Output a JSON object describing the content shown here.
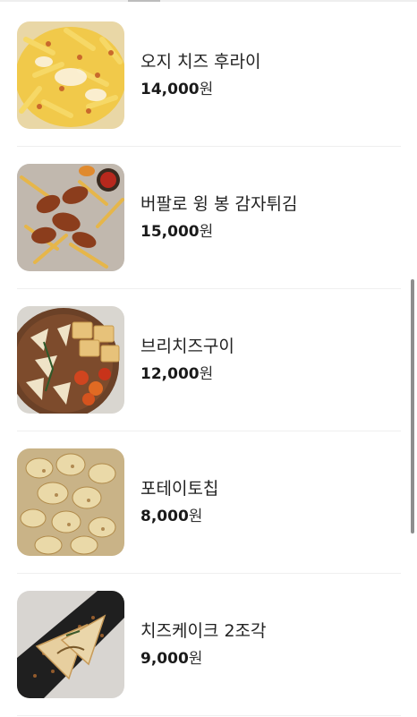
{
  "menu": {
    "items": [
      {
        "name": "오지 치즈 후라이",
        "price": "14,000",
        "unit": "원",
        "image": "loaded-cheese-fries"
      },
      {
        "name": "버팔로 윙 봉 감자튀김",
        "price": "15,000",
        "unit": "원",
        "image": "buffalo-wings-fries"
      },
      {
        "name": "브리치즈구이",
        "price": "12,000",
        "unit": "원",
        "image": "grilled-brie-platter"
      },
      {
        "name": "포테이토칩",
        "price": "8,000",
        "unit": "원",
        "image": "potato-chips"
      },
      {
        "name": "치즈케이크 2조각",
        "price": "9,000",
        "unit": "원",
        "image": "cheesecake-slices"
      }
    ]
  }
}
